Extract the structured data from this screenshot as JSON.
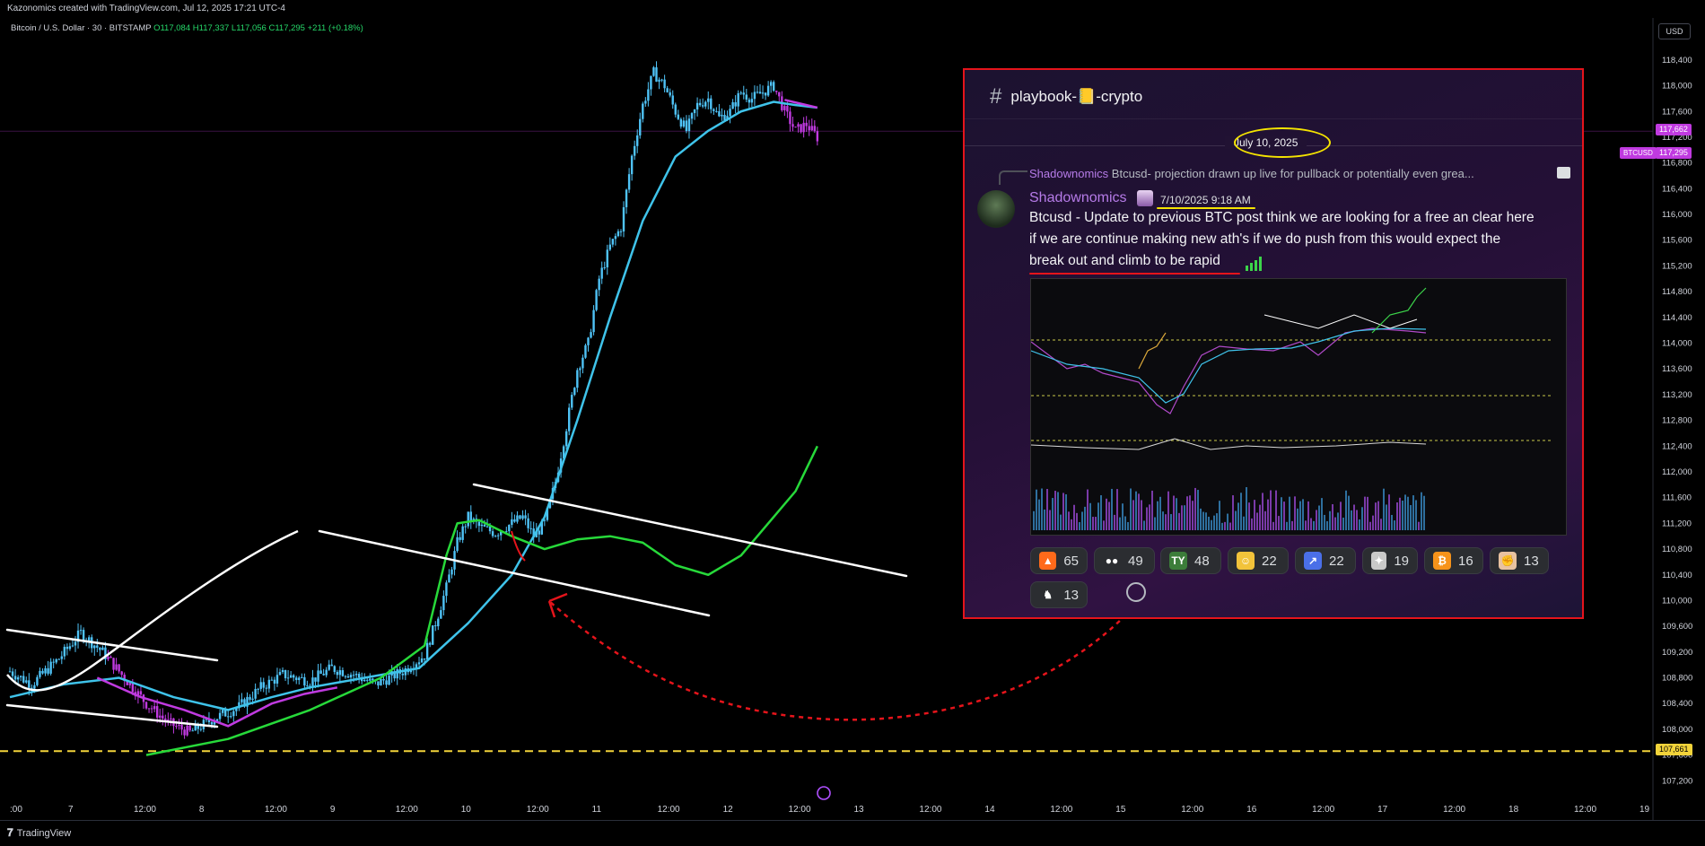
{
  "header": {
    "credit": "Kazonomics created with TradingView.com, Jul 12, 2025 17:21 UTC-4",
    "symbol": "Bitcoin / U.S. Dollar · 30 · BITSTAMP",
    "ohlc": {
      "o": "O117,084",
      "h": "H117,337",
      "l": "L117,056",
      "c": "C117,295",
      "chg": "+211 (+0.18%)"
    },
    "currency": "USD"
  },
  "price_tags": {
    "current_label": "BTCUSD",
    "current": "117,295",
    "ma": "117,662",
    "support": "107,661"
  },
  "colors": {
    "candles": "#4fc3f7",
    "ma_blue": "#3fc3ea",
    "ma_magenta": "#c03ae0",
    "green_curve": "#27d93a",
    "support_line": "#f2d33a",
    "projection_arrow": "#e5141b"
  },
  "chart_data": {
    "type": "candlestick",
    "title": "",
    "y_axis": {
      "min": 106800,
      "max": 118900,
      "ticks": [
        "118,400",
        "118,000",
        "117,600",
        "117,200",
        "116,800",
        "116,400",
        "116,000",
        "115,600",
        "115,200",
        "114,800",
        "114,400",
        "114,000",
        "113,600",
        "113,200",
        "112,800",
        "112,400",
        "112,000",
        "111,600",
        "111,200",
        "110,800",
        "110,400",
        "110,000",
        "109,600",
        "109,200",
        "108,800",
        "108,400",
        "108,000",
        "107,600",
        "107,200"
      ],
      "tick_values": [
        118400,
        118000,
        117600,
        117200,
        116800,
        116400,
        116000,
        115600,
        115200,
        114800,
        114400,
        114000,
        113600,
        113200,
        112800,
        112400,
        112000,
        111600,
        111200,
        110800,
        110400,
        110000,
        109600,
        109200,
        108800,
        108400,
        108000,
        107600,
        107200
      ]
    },
    "x_axis": {
      "labels": [
        ":00",
        "7",
        "12:00",
        "8",
        "12:00",
        "9",
        "12:00",
        "10",
        "12:00",
        "11",
        "12:00",
        "12",
        "12:00",
        "13",
        "12:00",
        "14",
        "12:00",
        "15",
        "12:00",
        "16",
        "12:00",
        "17",
        "12:00",
        "18",
        "12:00",
        "19"
      ],
      "hours_start": -0.5,
      "hours_end": 300.5
    },
    "price_path": [
      [
        0,
        108900
      ],
      [
        4,
        108700
      ],
      [
        9,
        109100
      ],
      [
        13,
        109500
      ],
      [
        17,
        109200
      ],
      [
        21,
        108800
      ],
      [
        25,
        108400
      ],
      [
        29,
        108100
      ],
      [
        33,
        107950
      ],
      [
        37,
        108150
      ],
      [
        42,
        108350
      ],
      [
        46,
        108650
      ],
      [
        50,
        108850
      ],
      [
        55,
        108750
      ],
      [
        59,
        108950
      ],
      [
        63,
        108850
      ],
      [
        67,
        108700
      ],
      [
        72,
        108900
      ],
      [
        76,
        109150
      ],
      [
        78,
        109650
      ],
      [
        80,
        110200
      ],
      [
        82,
        110900
      ],
      [
        84,
        111300
      ],
      [
        86,
        111150
      ],
      [
        89,
        111050
      ],
      [
        92,
        111200
      ],
      [
        94,
        111300
      ],
      [
        96,
        111000
      ],
      [
        98,
        111200
      ],
      [
        100,
        111850
      ],
      [
        102,
        112700
      ],
      [
        104,
        113600
      ],
      [
        106,
        114000
      ],
      [
        108,
        115000
      ],
      [
        110,
        115500
      ],
      [
        112,
        115800
      ],
      [
        114,
        116900
      ],
      [
        116,
        117700
      ],
      [
        118,
        118200
      ],
      [
        120,
        118000
      ],
      [
        122,
        117600
      ],
      [
        124,
        117300
      ],
      [
        126,
        117700
      ],
      [
        128,
        117800
      ],
      [
        130,
        117500
      ],
      [
        132,
        117600
      ],
      [
        134,
        117900
      ],
      [
        136,
        117800
      ],
      [
        138,
        117900
      ],
      [
        140,
        118000
      ],
      [
        142,
        117600
      ],
      [
        144,
        117300
      ],
      [
        146,
        117400
      ],
      [
        148,
        117200
      ]
    ],
    "series": [
      {
        "values": [
          [
            0,
            108500
          ],
          [
            10,
            108700
          ],
          [
            20,
            108800
          ],
          [
            30,
            108500
          ],
          [
            40,
            108300
          ],
          [
            48,
            108500
          ],
          [
            55,
            108650
          ],
          [
            65,
            108800
          ],
          [
            75,
            108950
          ],
          [
            84,
            109650
          ],
          [
            92,
            110400
          ],
          [
            98,
            111300
          ],
          [
            104,
            112800
          ],
          [
            110,
            114400
          ],
          [
            116,
            115900
          ],
          [
            122,
            116900
          ],
          [
            128,
            117300
          ],
          [
            134,
            117600
          ],
          [
            140,
            117750
          ],
          [
            144,
            117700
          ],
          [
            148,
            117660
          ]
        ]
      },
      {
        "values": [
          [
            16,
            108800
          ],
          [
            24,
            108500
          ],
          [
            32,
            108300
          ],
          [
            40,
            108050
          ],
          [
            48,
            108400
          ],
          [
            54,
            108550
          ],
          [
            60,
            108650
          ],
          [
            142,
            117780
          ],
          [
            148,
            117660
          ]
        ]
      },
      {
        "values": [
          [
            25,
            107600
          ],
          [
            40,
            107850
          ],
          [
            55,
            108300
          ],
          [
            68,
            108800
          ],
          [
            76,
            109300
          ],
          [
            80,
            110700
          ],
          [
            82,
            111200
          ],
          [
            86,
            111250
          ],
          [
            92,
            111000
          ],
          [
            98,
            110800
          ],
          [
            104,
            110950
          ],
          [
            110,
            111000
          ],
          [
            116,
            110900
          ],
          [
            122,
            110550
          ],
          [
            128,
            110400
          ],
          [
            134,
            110700
          ],
          [
            140,
            111300
          ],
          [
            144,
            111700
          ],
          [
            148,
            112400
          ]
        ]
      }
    ],
    "support_level": 107661,
    "current_price": 117295
  },
  "overlay": {
    "channel": "playbook-📒-crypto",
    "date": "July 10, 2025",
    "reply_author": "Shadownomics",
    "reply_text": "Btcusd- projection drawn up live for pullback or potentially even grea...",
    "author": "Shadownomics",
    "timestamp": "7/10/2025 9:18 AM",
    "message": [
      "Btcusd - Update to previous BTC post think we are looking for a free an clear here",
      "if we are continue making new ath's if we do push from this would expect the",
      "break out and climb to be rapid"
    ],
    "reactions": [
      {
        "emoji": "fire-icon",
        "count": "65",
        "color": "#ff6a1a"
      },
      {
        "emoji": "eyes-icon",
        "count": "49",
        "color": "#ffffff"
      },
      {
        "emoji": "ty-icon",
        "count": "48",
        "color": "#3c7d3a"
      },
      {
        "emoji": "salute-face-icon",
        "count": "22",
        "color": "#f2c33a"
      },
      {
        "emoji": "chart-dash-icon",
        "count": "22",
        "color": "#4a6fe8"
      },
      {
        "emoji": "pepe-icon",
        "count": "19",
        "color": "#c9c9c9"
      },
      {
        "emoji": "bitcoin-icon",
        "count": "16",
        "color": "#f7931a"
      },
      {
        "emoji": "fist-icon",
        "count": "13",
        "color": "#e8c2a0"
      },
      {
        "emoji": "goat-icon",
        "count": "13",
        "color": "#ffffff"
      }
    ]
  }
}
